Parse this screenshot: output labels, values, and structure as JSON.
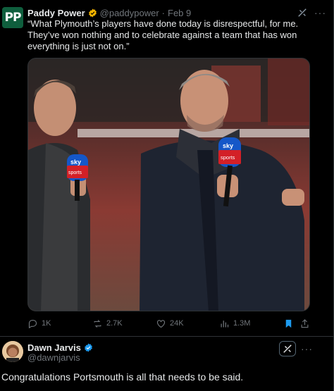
{
  "tweet": {
    "author": {
      "display_name": "Paddy Power",
      "handle": "@paddypower",
      "date": "Feb 9",
      "avatar_text": "PP",
      "verified_color": "#f4b400"
    },
    "text": "“What Plymouth’s players have done today is disrespectful, for me. They’ve won nothing and to celebrate against a team that has won everything is just not on.”",
    "media": {
      "mic_flag_top": "sky",
      "mic_flag_bottom": "sports"
    },
    "stats": {
      "replies": "1K",
      "reposts": "2.7K",
      "likes": "24K",
      "views": "1.3M"
    },
    "icons": {
      "reply": "reply-icon",
      "repost": "repost-icon",
      "like": "heart-icon",
      "views": "views-icon",
      "bookmark": "bookmark-icon",
      "share": "share-icon",
      "grok": "grok-icon",
      "more": "more-icon"
    },
    "accent_color": "#1d9bf0"
  },
  "reply": {
    "author": {
      "display_name": "Dawn Jarvis",
      "handle": "@dawnjarvis",
      "verified_color": "#1d9bf0"
    },
    "text": "Congratulations Portsmouth is all that needs to be said."
  },
  "more_glyph": "···"
}
